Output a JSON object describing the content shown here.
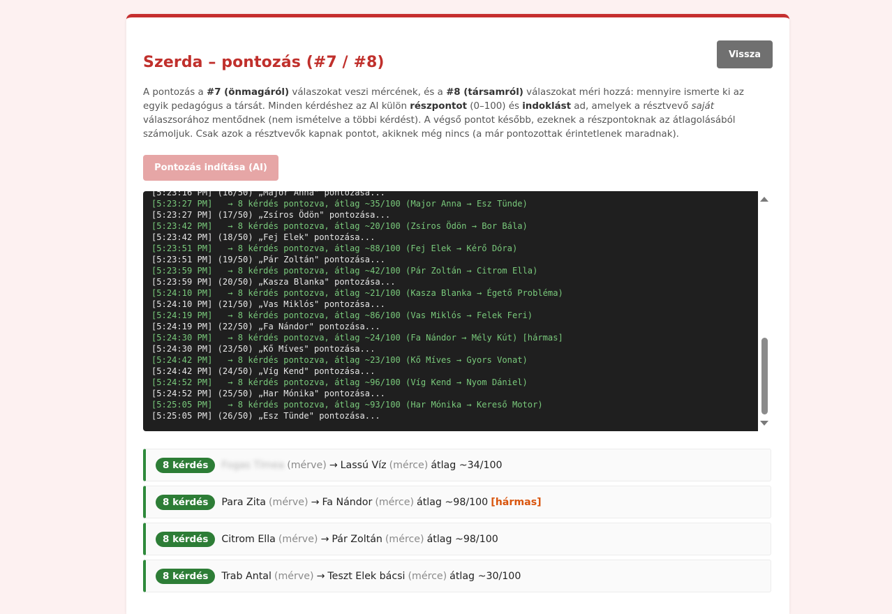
{
  "page": {
    "title": "Szerda – pontozás (#7 / #8)",
    "back_label": "Vissza",
    "start_label": "Pontozás indítása (AI)",
    "description": {
      "p1": "A pontozás a ",
      "b1": "#7 (önmagáról)",
      "p2": " válaszokat veszi mércének, és a ",
      "b2": "#8 (társamról)",
      "p3": " válaszokat méri hozzá: mennyire ismerte ki az egyik pedagógus a társát. Minden kérdéshez az AI külön ",
      "b3": "részpontot",
      "p4": " (0–100) és ",
      "b4": "indoklást",
      "p5": " ad, amelyek a résztvevő ",
      "i1": "saját",
      "p6": " válaszsorához mentődnek (nem ismételve a többi kérdést). A végső pontot később, ezeknek a részpontoknak az átlagolásából számoljuk. Csak azok a résztvevők kapnak pontot, akiknek még nincs (a már pontozottak érintetlenek maradnak)."
    }
  },
  "log": [
    {
      "type": "info",
      "text": "[5:23:16 PM] (16/50) „Major Anna\" pontozása..."
    },
    {
      "type": "ok",
      "text": "[5:23:27 PM]   → 8 kérdés pontozva, átlag ~35/100 (Major Anna → Esz Tünde)"
    },
    {
      "type": "info",
      "text": "[5:23:27 PM] (17/50) „Zsíros Ödön\" pontozása..."
    },
    {
      "type": "ok",
      "text": "[5:23:42 PM]   → 8 kérdés pontozva, átlag ~20/100 (Zsíros Ödön → Bor Bála)"
    },
    {
      "type": "info",
      "text": "[5:23:42 PM] (18/50) „Fej Elek\" pontozása..."
    },
    {
      "type": "ok",
      "text": "[5:23:51 PM]   → 8 kérdés pontozva, átlag ~88/100 (Fej Elek → Kérő Dóra)"
    },
    {
      "type": "info",
      "text": "[5:23:51 PM] (19/50) „Pár Zoltán\" pontozása..."
    },
    {
      "type": "ok",
      "text": "[5:23:59 PM]   → 8 kérdés pontozva, átlag ~42/100 (Pár Zoltán → Citrom Ella)"
    },
    {
      "type": "info",
      "text": "[5:23:59 PM] (20/50) „Kasza Blanka\" pontozása..."
    },
    {
      "type": "ok",
      "text": "[5:24:10 PM]   → 8 kérdés pontozva, átlag ~21/100 (Kasza Blanka → Égető Probléma)"
    },
    {
      "type": "info",
      "text": "[5:24:10 PM] (21/50) „Vas Miklós\" pontozása..."
    },
    {
      "type": "ok",
      "text": "[5:24:19 PM]   → 8 kérdés pontozva, átlag ~86/100 (Vas Miklós → Felek Feri)"
    },
    {
      "type": "info",
      "text": "[5:24:19 PM] (22/50) „Fa Nándor\" pontozása..."
    },
    {
      "type": "ok",
      "text": "[5:24:30 PM]   → 8 kérdés pontozva, átlag ~24/100 (Fa Nándor → Mély Kút) [hármas]"
    },
    {
      "type": "info",
      "text": "[5:24:30 PM] (23/50) „Kő Míves\" pontozása..."
    },
    {
      "type": "ok",
      "text": "[5:24:42 PM]   → 8 kérdés pontozva, átlag ~23/100 (Kő Míves → Gyors Vonat)"
    },
    {
      "type": "info",
      "text": "[5:24:42 PM] (24/50) „Víg Kend\" pontozása..."
    },
    {
      "type": "ok",
      "text": "[5:24:52 PM]   → 8 kérdés pontozva, átlag ~96/100 (Víg Kend → Nyom Dániel)"
    },
    {
      "type": "info",
      "text": "[5:24:52 PM] (25/50) „Har Mónika\" pontozása..."
    },
    {
      "type": "ok",
      "text": "[5:25:05 PM]   → 8 kérdés pontozva, átlag ~93/100 (Har Mónika → Kereső Motor)"
    },
    {
      "type": "info",
      "text": "[5:25:05 PM] (26/50) „Esz Tünde\" pontozása..."
    }
  ],
  "results": [
    {
      "badge": "8 kérdés",
      "from": "Fogas Tímea",
      "from_tag": "(mérve)",
      "arrow": "→",
      "to": "Lassú Víz",
      "to_tag": "(mérce)",
      "avg": "átlag ~34/100",
      "flag": "",
      "blurred": true
    },
    {
      "badge": "8 kérdés",
      "from": "Para Zita",
      "from_tag": "(mérve)",
      "arrow": "→",
      "to": "Fa Nándor",
      "to_tag": "(mérce)",
      "avg": "átlag ~98/100",
      "flag": "[hármas]",
      "blurred": false
    },
    {
      "badge": "8 kérdés",
      "from": "Citrom Ella",
      "from_tag": "(mérve)",
      "arrow": "→",
      "to": "Pár Zoltán",
      "to_tag": "(mérce)",
      "avg": "átlag ~98/100",
      "flag": "",
      "blurred": false
    },
    {
      "badge": "8 kérdés",
      "from": "Trab Antal",
      "from_tag": "(mérve)",
      "arrow": "→",
      "to": "Teszt Elek bácsi",
      "to_tag": "(mérce)",
      "avg": "átlag ~30/100",
      "flag": "",
      "blurred": false
    }
  ],
  "colors": {
    "accent": "#c62f2f",
    "badge": "#2d7d36",
    "log_ok": "#79c97b",
    "flag": "#d9560f"
  }
}
